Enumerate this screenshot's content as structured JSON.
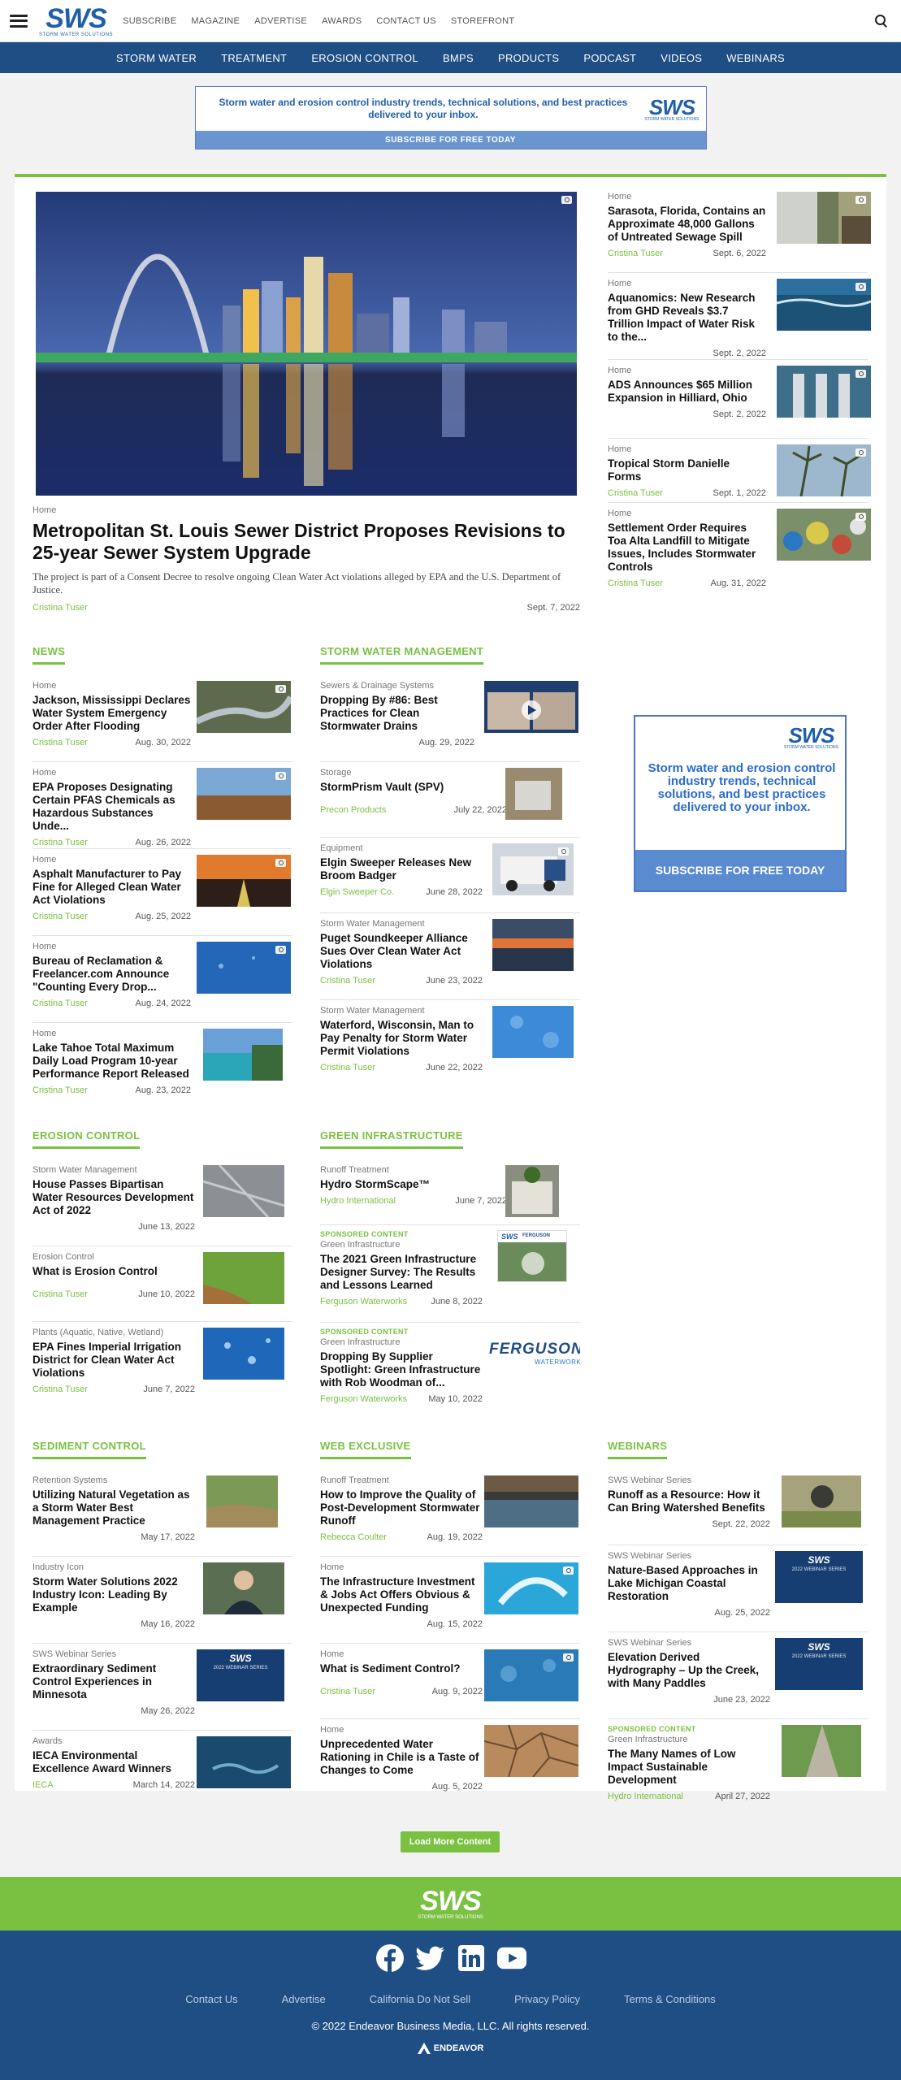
{
  "top": {
    "logo": "SWS",
    "logo_sub": "STORM WATER SOLUTIONS",
    "links": [
      "SUBSCRIBE",
      "MAGAZINE",
      "ADVERTISE",
      "AWARDS",
      "CONTACT US",
      "STOREFRONT"
    ]
  },
  "nav": [
    "STORM WATER",
    "TREATMENT",
    "EROSION CONTROL",
    "BMPS",
    "PRODUCTS",
    "PODCAST",
    "VIDEOS",
    "WEBINARS"
  ],
  "ad": {
    "text": "Storm water and erosion control industry trends, technical solutions, and best practices delivered to your inbox.",
    "cta": "SUBSCRIBE FOR FREE TODAY",
    "logo": "SWS",
    "logo_sub": "STORM WATER SOLUTIONS"
  },
  "hero": {
    "cat": "Home",
    "title": "Metropolitan St. Louis Sewer District Proposes Revisions to 25-year Sewer System Upgrade",
    "desc": "The project is part of a Consent Decree to resolve ongoing Clean Water Act violations alleged by EPA and the U.S. Department of Justice.",
    "author": "Cristina Tuser",
    "date": "Sept. 7, 2022"
  },
  "side": [
    {
      "cat": "Home",
      "title": "Sarasota, Florida, Contains an Approximate 48,000 Gallons of Untreated Sewage Spill",
      "author": "Cristina Tuser",
      "date": "Sept. 6, 2022"
    },
    {
      "cat": "Home",
      "title": "Aquanomics: New Research from GHD Reveals $3.7 Trillion Impact of Water Risk to the...",
      "author": "",
      "date": "Sept. 2, 2022"
    },
    {
      "cat": "Home",
      "title": "ADS Announces $65 Million Expansion in Hilliard, Ohio",
      "author": "",
      "date": "Sept. 2, 2022"
    },
    {
      "cat": "Home",
      "title": "Tropical Storm Danielle Forms",
      "author": "Cristina Tuser",
      "date": "Sept. 1, 2022"
    },
    {
      "cat": "Home",
      "title": "Settlement Order Requires Toa Alta Landfill to Mitigate Issues, Includes Stormwater Controls",
      "author": "Cristina Tuser",
      "date": "Aug. 31, 2022"
    }
  ],
  "news": {
    "head": "NEWS",
    "items": [
      {
        "cat": "Home",
        "title": "Jackson, Mississippi Declares Water System Emergency Order After Flooding",
        "author": "Cristina Tuser",
        "date": "Aug. 30, 2022"
      },
      {
        "cat": "Home",
        "title": "EPA Proposes Designating Certain PFAS Chemicals as Hazardous Substances Unde...",
        "author": "Cristina Tuser",
        "date": "Aug. 26, 2022"
      },
      {
        "cat": "Home",
        "title": "Asphalt Manufacturer to Pay Fine for Alleged Clean Water Act Violations",
        "author": "Cristina Tuser",
        "date": "Aug. 25, 2022"
      },
      {
        "cat": "Home",
        "title": "Bureau of Reclamation & Freelancer.com Announce \"Counting Every Drop...",
        "author": "Cristina Tuser",
        "date": "Aug. 24, 2022"
      },
      {
        "cat": "Home",
        "title": "Lake Tahoe Total Maximum Daily Load Program 10-year Performance Report Released",
        "author": "Cristina Tuser",
        "date": "Aug. 23, 2022"
      }
    ]
  },
  "swm": {
    "head": "STORM WATER MANAGEMENT",
    "items": [
      {
        "cat": "Sewers & Drainage Systems",
        "title": "Dropping By #86: Best Practices for Clean Stormwater Drains",
        "author": "",
        "date": "Aug. 29, 2022"
      },
      {
        "cat": "Storage",
        "title": "StormPrism Vault (SPV)",
        "author": "Precon Products",
        "date": "July 22, 2022"
      },
      {
        "cat": "Equipment",
        "title": "Elgin Sweeper Releases New Broom Badger",
        "author": "Elgin Sweeper Co.",
        "date": "June 28, 2022"
      },
      {
        "cat": "Storm Water Management",
        "title": "Puget Soundkeeper Alliance Sues Over Clean Water Act Violations",
        "author": "Cristina Tuser",
        "date": "June 23, 2022"
      },
      {
        "cat": "Storm Water Management",
        "title": "Waterford, Wisconsin, Man to Pay Penalty for Storm Water Permit Violations",
        "author": "Cristina Tuser",
        "date": "June 22, 2022"
      }
    ]
  },
  "ad2": {
    "logo": "SWS",
    "logo_sub": "STORM WATER SOLUTIONS",
    "text": "Storm water and erosion control industry trends, technical solutions, and best practices delivered to your inbox.",
    "cta": "SUBSCRIBE FOR FREE TODAY"
  },
  "erosion": {
    "head": "EROSION CONTROL",
    "items": [
      {
        "cat": "Storm Water Management",
        "title": "House Passes Bipartisan Water Resources Development Act of 2022",
        "author": "",
        "date": "June 13, 2022"
      },
      {
        "cat": "Erosion Control",
        "title": "What is Erosion Control",
        "author": "Cristina Tuser",
        "date": "June 10, 2022"
      },
      {
        "cat": "Plants (Aquatic, Native, Wetland)",
        "title": "EPA Fines Imperial Irrigation District for Clean Water Act Violations",
        "author": "Cristina Tuser",
        "date": "June 7, 2022"
      }
    ]
  },
  "green": {
    "head": "GREEN INFRASTRUCTURE",
    "items": [
      {
        "sponsored": "",
        "cat": "Runoff Treatment",
        "title": "Hydro StormScape™",
        "author": "Hydro International",
        "date": "June 7, 2022"
      },
      {
        "sponsored": "SPONSORED CONTENT",
        "cat": "Green Infrastructure",
        "title": "The 2021 Green Infrastructure Designer Survey: The Results and Lessons Learned",
        "author": "Ferguson Waterworks",
        "date": "June 8, 2022"
      },
      {
        "sponsored": "SPONSORED CONTENT",
        "cat": "Green Infrastructure",
        "title": "Dropping By Supplier Spotlight: Green Infrastructure with Rob Woodman of...",
        "author": "Ferguson Waterworks",
        "date": "May 10, 2022"
      }
    ],
    "logo1": "SWS",
    "logo1b": "FERGUSON",
    "logo2a": "FERGUSON",
    "logo2b": "WATERWORKS"
  },
  "sediment": {
    "head": "SEDIMENT CONTROL",
    "items": [
      {
        "cat": "Retention Systems",
        "title": "Utilizing Natural Vegetation as a Storm Water Best Management Practice",
        "author": "",
        "date": "May 17, 2022"
      },
      {
        "cat": "Industry Icon",
        "title": "Storm Water Solutions 2022 Industry Icon: Leading By Example",
        "author": "",
        "date": "May 16, 2022"
      },
      {
        "cat": "SWS Webinar Series",
        "title": "Extraordinary Sediment Control Experiences in Minnesota",
        "author": "",
        "date": "May 26, 2022"
      },
      {
        "cat": "Awards",
        "title": "IECA Environmental Excellence Award Winners",
        "author": "IECA",
        "date": "March 14, 2022"
      }
    ]
  },
  "web": {
    "head": "WEB EXCLUSIVE",
    "items": [
      {
        "cat": "Runoff Treatment",
        "title": "How to Improve the Quality of Post-Development Stormwater Runoff",
        "author": "Rebecca Coulter",
        "date": "Aug. 19, 2022"
      },
      {
        "cat": "Home",
        "title": "The Infrastructure Investment & Jobs Act Offers Obvious & Unexpected Funding",
        "author": "",
        "date": "Aug. 15, 2022"
      },
      {
        "cat": "Home",
        "title": "What is Sediment Control?",
        "author": "Cristina Tuser",
        "date": "Aug. 9, 2022"
      },
      {
        "cat": "Home",
        "title": "Unprecedented Water Rationing in Chile is a Taste of Changes to Come",
        "author": "",
        "date": "Aug. 5, 2022"
      }
    ]
  },
  "webinars": {
    "head": "WEBINARS",
    "items": [
      {
        "sponsored": "",
        "cat": "SWS Webinar Series",
        "title": "Runoff as a Resource: How it Can Bring Watershed Benefits",
        "author": "",
        "date": "Sept. 22, 2022"
      },
      {
        "sponsored": "",
        "cat": "SWS Webinar Series",
        "title": "Nature-Based Approaches in Lake Michigan Coastal Restoration",
        "author": "",
        "date": "Aug. 25, 2022"
      },
      {
        "sponsored": "",
        "cat": "SWS Webinar Series",
        "title": "Elevation Derived Hydrography – Up the Creek, with Many Paddles",
        "author": "",
        "date": "June 23, 2022"
      },
      {
        "sponsored": "SPONSORED CONTENT",
        "cat": "Green Infrastructure",
        "title": "The Many Names of Low Impact Sustainable Development",
        "author": "Hydro International",
        "date": "April 27, 2022"
      }
    ]
  },
  "webinar_thumb": {
    "logo": "SWS",
    "line1": "2022 WEBINAR SERIES"
  },
  "load_more": "Load More Content",
  "footer": {
    "logo": "SWS",
    "logo_sub": "STORM WATER SOLUTIONS",
    "links": [
      "Contact Us",
      "Advertise",
      "California Do Not Sell",
      "Privacy Policy",
      "Terms & Conditions"
    ],
    "copyright": "© 2022 Endeavor Business Media, LLC. All rights reserved.",
    "brand": "ENDEAVOR"
  },
  "colors": {
    "brand_blue": "#1f4e85",
    "accent_green": "#7ac142"
  }
}
